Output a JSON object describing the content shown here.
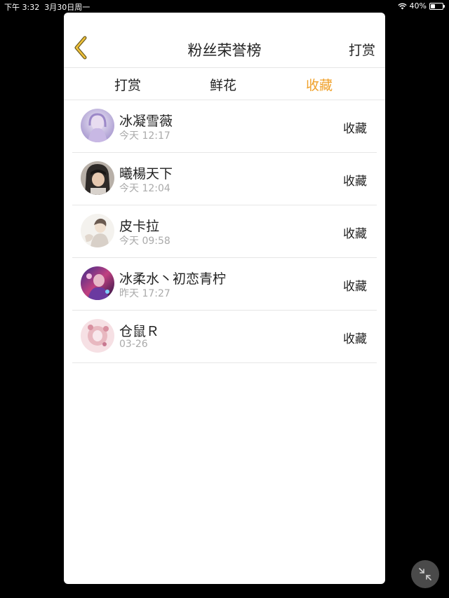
{
  "status_bar": {
    "time": "下午 3:32",
    "date": "3月30日周一",
    "battery": "40%",
    "battery_level": 0.4
  },
  "header": {
    "title": "粉丝荣誉榜",
    "action_label": "打赏",
    "back_icon": "chevron-left-icon",
    "accent_color": "#f0a12a"
  },
  "tabs": [
    {
      "label": "打赏",
      "active": false
    },
    {
      "label": "鲜花",
      "active": false
    },
    {
      "label": "收藏",
      "active": true
    }
  ],
  "list": [
    {
      "name": "冰凝雪薇",
      "time": "今天 12:17",
      "action": "收藏"
    },
    {
      "name": "曦楊天下",
      "time": "今天 12:04",
      "action": "收藏"
    },
    {
      "name": "皮卡拉",
      "time": "今天 09:58",
      "action": "收藏"
    },
    {
      "name": "冰柔水丶初恋青柠",
      "time": "昨天 17:27",
      "action": "收藏"
    },
    {
      "name": "仓鼠Ｒ",
      "time": "03-26",
      "action": "收藏"
    }
  ],
  "float_button_icon": "collapse-icon"
}
